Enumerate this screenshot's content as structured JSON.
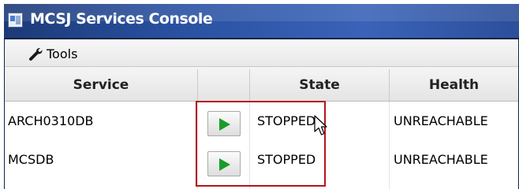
{
  "window": {
    "title": "MCSJ Services Console",
    "icon": "app-icon"
  },
  "toolbar": {
    "tools_label": "Tools",
    "tools_icon": "wrench-icon"
  },
  "table": {
    "columns": [
      "Service",
      "",
      "State",
      "Health"
    ],
    "rows": [
      {
        "service": "ARCH0310DB",
        "action_icon": "play-icon",
        "state": "STOPPED",
        "health": "UNREACHABLE"
      },
      {
        "service": "MCSDB",
        "action_icon": "play-icon",
        "state": "STOPPED",
        "health": "UNREACHABLE"
      }
    ]
  },
  "colors": {
    "title_bar": "#2a52a2",
    "play_green": "#1a9c2a",
    "highlight": "#b3141c"
  }
}
